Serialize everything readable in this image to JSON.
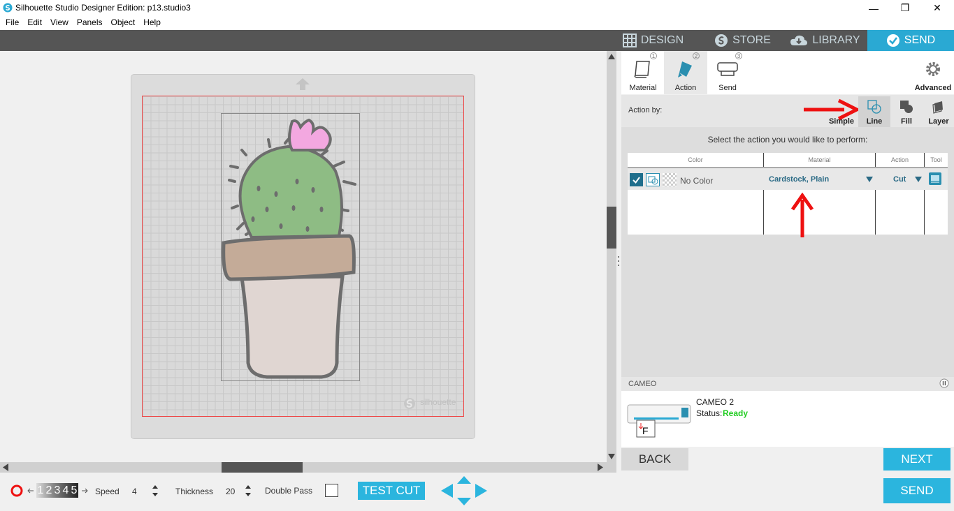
{
  "titlebar": {
    "title": "Silhouette Studio Designer Edition: p13.studio3",
    "minimize": "—",
    "restore": "❐",
    "close": "✕"
  },
  "menu": [
    "File",
    "Edit",
    "View",
    "Panels",
    "Object",
    "Help"
  ],
  "topnav": {
    "design": "DESIGN",
    "store": "STORE",
    "library": "LIBRARY",
    "send": "SEND"
  },
  "subtabs": {
    "material": "Material",
    "action": "Action",
    "send": "Send",
    "advanced": "Advanced",
    "n1": "1",
    "n2": "2",
    "n3": "3"
  },
  "action_by": {
    "label": "Action by:",
    "simple": "Simple",
    "line": "Line",
    "fill": "Fill",
    "layer": "Layer"
  },
  "prompt": "Select the action you would like to perform:",
  "table": {
    "headers": {
      "color": "Color",
      "material": "Material",
      "action": "Action",
      "tool": "Tool"
    },
    "rows": [
      {
        "color": "No Color",
        "material": "Cardstock, Plain",
        "action": "Cut"
      }
    ]
  },
  "device": {
    "section": "CAMEO",
    "name": "CAMEO 2",
    "status_label": "Status:",
    "status": "Ready",
    "status_color": "#22cc22"
  },
  "buttons": {
    "back": "BACK",
    "next": "NEXT",
    "send": "SEND",
    "test_cut": "TEST CUT"
  },
  "bottom": {
    "passes": [
      "1",
      "2",
      "3",
      "4",
      "5"
    ],
    "speed_label": "Speed",
    "speed": "4",
    "thickness_label": "Thickness",
    "thickness": "20",
    "double_pass_label": "Double Pass"
  },
  "mat_watermark": "silhouette",
  "colors": {
    "accent": "#2bb5de",
    "arrow": "#ee1111"
  }
}
